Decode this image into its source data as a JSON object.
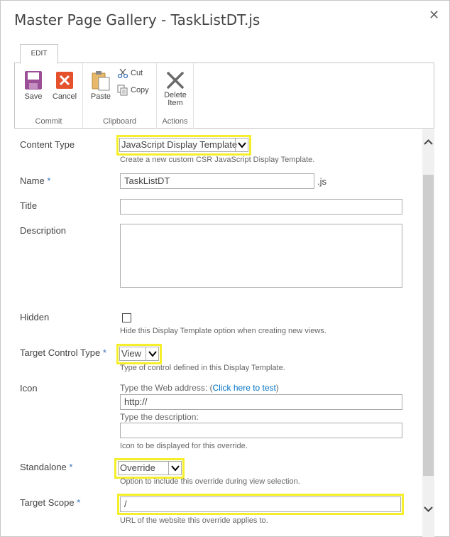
{
  "dialog": {
    "title": "Master Page Gallery - TaskListDT.js",
    "close_glyph": "✕"
  },
  "ribbon": {
    "tab": "EDIT",
    "groups": {
      "commit": {
        "label": "Commit",
        "save": "Save",
        "cancel": "Cancel"
      },
      "clipboard": {
        "label": "Clipboard",
        "paste": "Paste",
        "cut": "Cut",
        "copy": "Copy"
      },
      "actions": {
        "label": "Actions",
        "delete_line1": "Delete",
        "delete_line2": "Item"
      }
    },
    "colors": {
      "save_icon": "#9b4f96",
      "cancel_icon": "#e5512d"
    }
  },
  "form": {
    "content_type": {
      "label": "Content Type",
      "value": "JavaScript Display Template",
      "hint": "Create a new custom CSR JavaScript Display Template."
    },
    "name": {
      "label": "Name",
      "required": "*",
      "value": "TaskListDT",
      "suffix": ".js"
    },
    "title": {
      "label": "Title",
      "value": ""
    },
    "description": {
      "label": "Description",
      "value": ""
    },
    "hidden": {
      "label": "Hidden",
      "checked": false,
      "hint": "Hide this Display Template option when creating new views."
    },
    "target_control_type": {
      "label": "Target Control Type",
      "required": "*",
      "value": "View",
      "hint": "Type of control defined in this Display Template."
    },
    "icon": {
      "label": "Icon",
      "address_label": "Type the Web address: (",
      "test_link": "Click here to test",
      "address_close": ")",
      "url_value": "http://",
      "description_label": "Type the description:",
      "description_value": "",
      "hint": "Icon to be displayed for this override."
    },
    "standalone": {
      "label": "Standalone",
      "required": "*",
      "value": "Override",
      "hint": "Option to include this override during view selection."
    },
    "target_scope": {
      "label": "Target Scope",
      "required": "*",
      "value": "/",
      "hint": "URL of the website this override applies to."
    }
  },
  "highlight_color": "#f5ee2a",
  "required_color": "#3b73b9"
}
